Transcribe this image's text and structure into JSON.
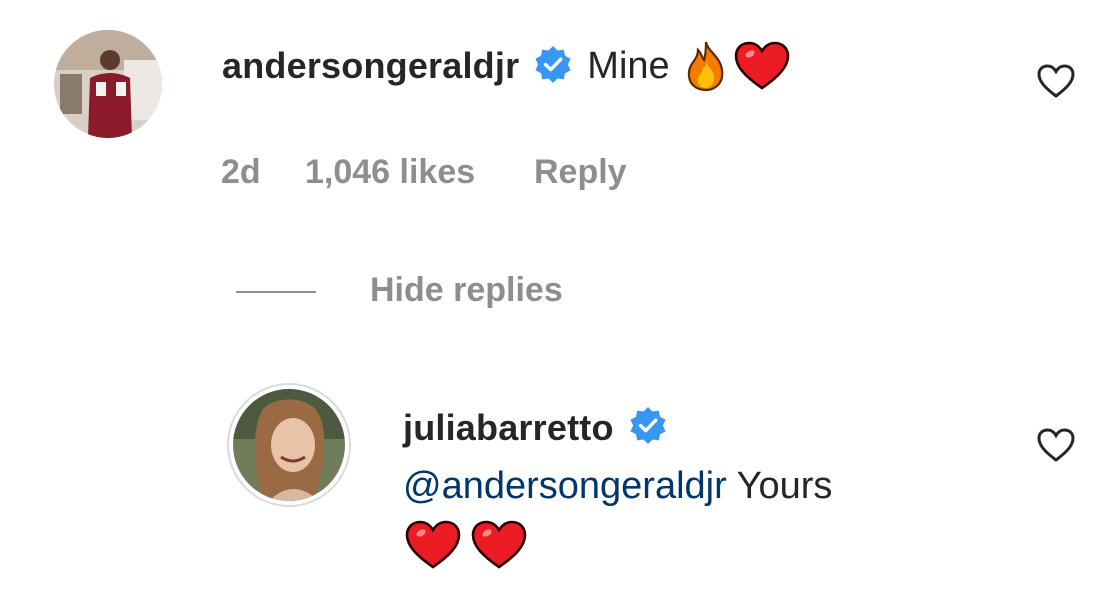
{
  "comment": {
    "username": "andersongeraldjr",
    "text": "Mine",
    "emojis": [
      "fire-emoji",
      "red-heart-emoji"
    ],
    "time": "2d",
    "likes": "1,046 likes",
    "reply_label": "Reply",
    "like_icon": "heart-outline-icon"
  },
  "hide_replies_label": "Hide replies",
  "reply": {
    "username": "juliabarretto",
    "mention": "@andersongeraldjr",
    "text": "Yours",
    "emojis": [
      "red-heart-emoji",
      "red-heart-emoji"
    ],
    "like_icon": "heart-outline-icon"
  },
  "colors": {
    "text": "#262626",
    "secondary": "#8e8e8e",
    "mention": "#00376b",
    "verified": "#3897f0",
    "heart": "#ed1c24"
  }
}
